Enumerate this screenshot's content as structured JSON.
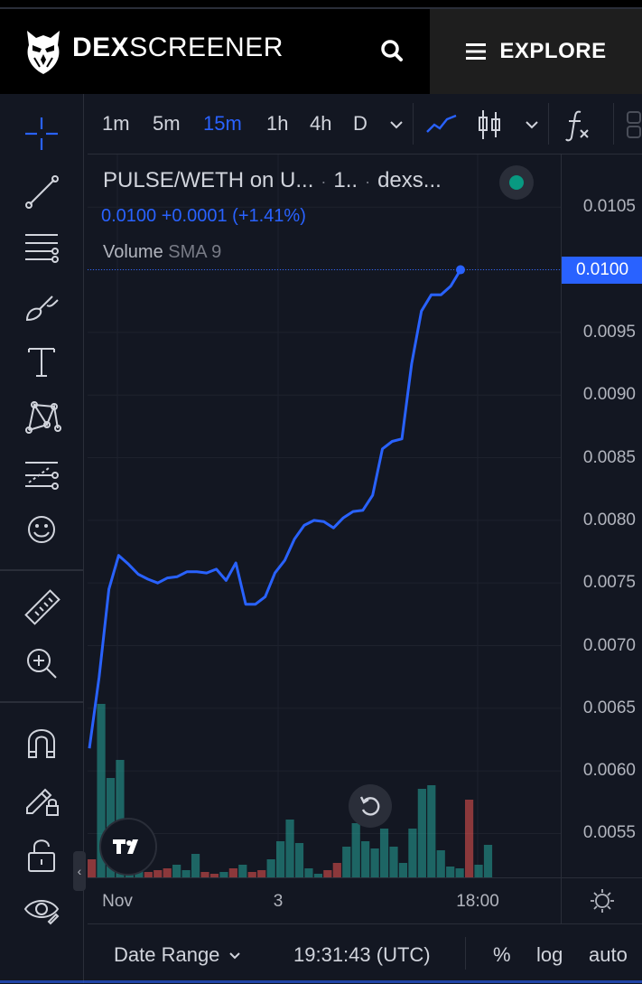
{
  "header": {
    "brand_bold": "DEX",
    "brand_thin": "SCREENER",
    "explore_label": "EXPLORE"
  },
  "toolbar": {
    "intervals": [
      "1m",
      "5m",
      "15m",
      "1h",
      "4h",
      "D"
    ],
    "active_interval": "15m"
  },
  "legend": {
    "title": "PULSE/WETH on U...",
    "interval_short": "1..",
    "source": "dexs...",
    "price": "0.0100",
    "change": "+0.0001",
    "change_pct": "(+1.41%)",
    "volume_label": "Volume",
    "volume_indicator": "SMA 9"
  },
  "status": {
    "live": true,
    "color": "#089981"
  },
  "chart_data": {
    "type": "line",
    "price_ticks": [
      "0.0105",
      "0.0100",
      "0.0095",
      "0.0090",
      "0.0085",
      "0.0080",
      "0.0075",
      "0.0070",
      "0.0065",
      "0.0060",
      "0.0055"
    ],
    "current_price_label": "0.0100",
    "current_price": 0.01,
    "time_ticks": [
      "Nov",
      "3",
      "18:00"
    ],
    "ylim": [
      0.00515,
      0.01092
    ],
    "line_color": "#2962ff",
    "up_color": "#26a69a",
    "down_color": "#ef5350",
    "price_series": [
      0.00618,
      0.00675,
      0.00745,
      0.00772,
      0.00765,
      0.00757,
      0.00753,
      0.0075,
      0.00754,
      0.00755,
      0.00759,
      0.00759,
      0.00758,
      0.00761,
      0.00752,
      0.00766,
      0.00733,
      0.00733,
      0.00739,
      0.00758,
      0.00768,
      0.00785,
      0.00796,
      0.008,
      0.00799,
      0.00794,
      0.00802,
      0.00807,
      0.00808,
      0.0082,
      0.00857,
      0.00863,
      0.00865,
      0.00925,
      0.00967,
      0.0098,
      0.0098,
      0.00987,
      0.01
    ],
    "volume_series": [
      {
        "v": 0.1,
        "up": false
      },
      {
        "v": 0.96,
        "up": true
      },
      {
        "v": 0.55,
        "up": true
      },
      {
        "v": 0.65,
        "up": true
      },
      {
        "v": 0.17,
        "up": true
      },
      {
        "v": 0.06,
        "up": true
      },
      {
        "v": 0.03,
        "up": false
      },
      {
        "v": 0.04,
        "up": false
      },
      {
        "v": 0.05,
        "up": false
      },
      {
        "v": 0.07,
        "up": true
      },
      {
        "v": 0.04,
        "up": true
      },
      {
        "v": 0.13,
        "up": true
      },
      {
        "v": 0.03,
        "up": false
      },
      {
        "v": 0.02,
        "up": false
      },
      {
        "v": 0.03,
        "up": true
      },
      {
        "v": 0.05,
        "up": false
      },
      {
        "v": 0.07,
        "up": true
      },
      {
        "v": 0.03,
        "up": false
      },
      {
        "v": 0.04,
        "up": false
      },
      {
        "v": 0.1,
        "up": true
      },
      {
        "v": 0.2,
        "up": true
      },
      {
        "v": 0.32,
        "up": true
      },
      {
        "v": 0.19,
        "up": true
      },
      {
        "v": 0.05,
        "up": true
      },
      {
        "v": 0.02,
        "up": true
      },
      {
        "v": 0.04,
        "up": false
      },
      {
        "v": 0.08,
        "up": false
      },
      {
        "v": 0.17,
        "up": true
      },
      {
        "v": 0.3,
        "up": true
      },
      {
        "v": 0.2,
        "up": true
      },
      {
        "v": 0.16,
        "up": true
      },
      {
        "v": 0.27,
        "up": true
      },
      {
        "v": 0.17,
        "up": true
      },
      {
        "v": 0.08,
        "up": true
      },
      {
        "v": 0.27,
        "up": true
      },
      {
        "v": 0.49,
        "up": true
      },
      {
        "v": 0.51,
        "up": true
      },
      {
        "v": 0.15,
        "up": true
      },
      {
        "v": 0.06,
        "up": true
      },
      {
        "v": 0.05,
        "up": true
      },
      {
        "v": 0.43,
        "up": false
      },
      {
        "v": 0.07,
        "up": true
      },
      {
        "v": 0.18,
        "up": true
      }
    ]
  },
  "bottom": {
    "date_range": "Date Range",
    "clock": "19:31:43 (UTC)",
    "percent": "%",
    "log": "log",
    "auto": "auto"
  }
}
